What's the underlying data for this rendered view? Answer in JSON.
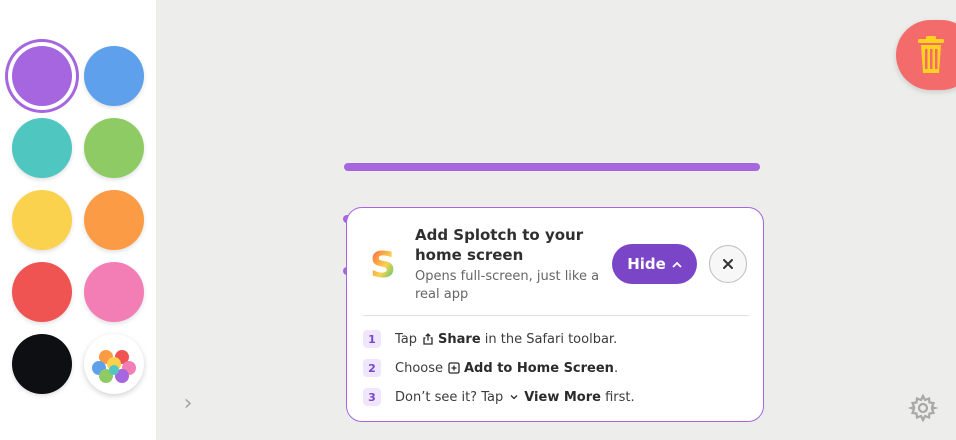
{
  "palette": {
    "colors": [
      "#a566e0",
      "#5ea0ec",
      "#4fc6c0",
      "#8fcb65",
      "#fbd24e",
      "#fb9b45",
      "#ef5453",
      "#f27eb5",
      "#0e0f12"
    ],
    "selected": "#a566e0"
  },
  "canvas": {
    "stroke_color": "#a566e0",
    "background": "#ededeb"
  },
  "trash": {
    "color": "#f36b6b",
    "icon": "trash-icon"
  },
  "install_prompt": {
    "title": "Add Splotch to your home screen",
    "subtitle": "Opens full-screen, just like a real app",
    "hide_label": "Hide",
    "close_icon": "✕",
    "steps": [
      {
        "number": "1",
        "prefix": "Tap",
        "icon": "share-icon",
        "action": "Share",
        "suffix": "in the Safari toolbar."
      },
      {
        "number": "2",
        "prefix": "Choose",
        "icon": "add-square-icon",
        "action": "Add to Home Screen",
        "suffix": "."
      },
      {
        "number": "3",
        "prefix": "Don’t see it? Tap",
        "icon": "chevron-down-icon",
        "action": "View More",
        "suffix": "first."
      }
    ]
  },
  "accent_color": "#7b45c8"
}
